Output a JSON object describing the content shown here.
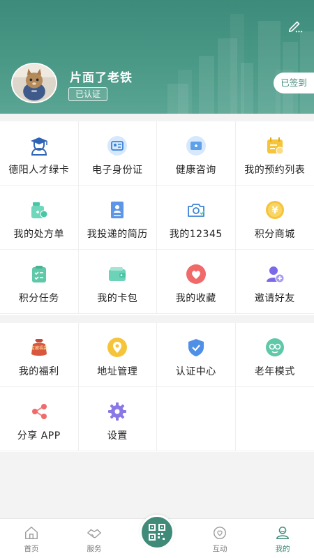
{
  "profile": {
    "username": "片面了老铁",
    "badge": "已认证",
    "signin_label": "已签到",
    "edit_icon": "edit-icon",
    "avatar": "cat-avatar"
  },
  "services_primary": [
    {
      "label": "德阳人才绿卡",
      "icon": "talent-icon"
    },
    {
      "label": "电子身份证",
      "icon": "id-card-icon"
    },
    {
      "label": "健康咨询",
      "icon": "health-icon"
    },
    {
      "label": "我的预约列表",
      "icon": "calendar-icon"
    },
    {
      "label": "我的处方单",
      "icon": "prescription-icon"
    },
    {
      "label": "我投递的简历",
      "icon": "resume-icon"
    },
    {
      "label": "我的12345",
      "icon": "camera-icon"
    },
    {
      "label": "积分商城",
      "icon": "yen-icon"
    },
    {
      "label": "积分任务",
      "icon": "task-icon"
    },
    {
      "label": "我的卡包",
      "icon": "wallet-icon"
    },
    {
      "label": "我的收藏",
      "icon": "heart-icon"
    },
    {
      "label": "邀请好友",
      "icon": "invite-icon"
    }
  ],
  "services_secondary": [
    {
      "label": "我的福利",
      "icon": "welfare-icon",
      "icon_text": "宝藏福袋"
    },
    {
      "label": "地址管理",
      "icon": "location-icon"
    },
    {
      "label": "认证中心",
      "icon": "shield-icon"
    },
    {
      "label": "老年模式",
      "icon": "elder-icon"
    },
    {
      "label": "分享 APP",
      "icon": "share-icon"
    },
    {
      "label": "设置",
      "icon": "gear-icon"
    }
  ],
  "nav": {
    "items": [
      {
        "label": "首页",
        "icon": "home-icon"
      },
      {
        "label": "服务",
        "icon": "handshake-icon"
      },
      {
        "label": "互动",
        "icon": "interact-icon"
      },
      {
        "label": "我的",
        "icon": "user-icon",
        "active": true
      }
    ],
    "center_icon": "qr-code-icon"
  },
  "colors": {
    "brand": "#3f8a78",
    "header": "#4a9886",
    "background": "#f3f3f3"
  }
}
